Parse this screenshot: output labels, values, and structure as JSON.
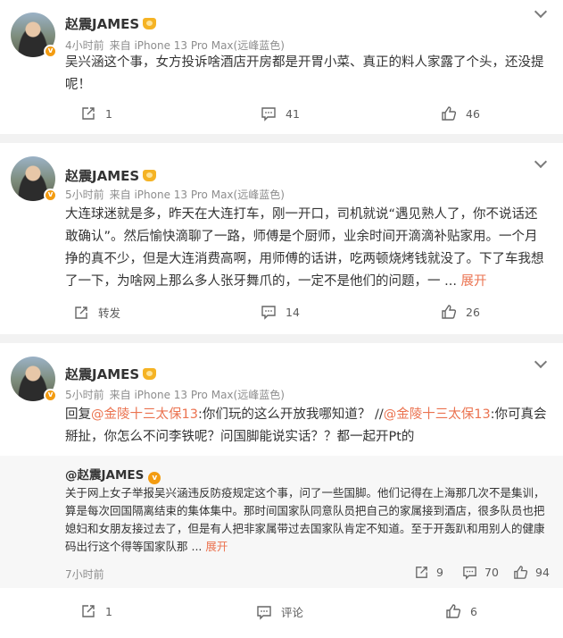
{
  "posts": [
    {
      "author": "赵震JAMES",
      "time": "4小时前",
      "source": "来自 iPhone 13 Pro Max(远峰蓝色)",
      "text": "吴兴涵这个事，女方投诉啥酒店开房都是开胃小菜、真正的料人家露了个头，还没提呢！",
      "repost": "1",
      "comments": "41",
      "likes": "46"
    },
    {
      "author": "赵震JAMES",
      "time": "5小时前",
      "source": "来自 iPhone 13 Pro Max(远峰蓝色)",
      "text": "大连球迷就是多，昨天在大连打车，刚一开口，司机就说“遇见熟人了，你不说话还敢确认”。然后愉快滴聊了一路，师傅是个厨师，业余时间开滴滴补贴家用。一个月挣的真不少，但是大连消费高啊，用师傅的话讲，吃两顿烧烤钱就没了。下了车我想了一下，为啥网上那么多人张牙舞爪的，一定不是他们的问题，一 ...",
      "more": "展开",
      "repost": "转发",
      "comments": "14",
      "likes": "26"
    },
    {
      "author": "赵震JAMES",
      "time": "5小时前",
      "source": "来自 iPhone 13 Pro Max(远峰蓝色)",
      "reply_prefix": "回复",
      "mention1": "@金陵十三太保13",
      "reply_mid": ":你们玩的这么开放我哪知道？ //",
      "mention2": "@金陵十三太保13",
      "reply_end": ":你可真会掰扯，你怎么不问李铁呢？问国脚能说实话？？都一起开Pt的",
      "quoted": {
        "author": "@赵震JAMES",
        "text": "关于网上女子举报吴兴涵违反防疫规定这个事，问了一些国脚。他们记得在上海那几次不是集训，算是每次回国隔离结束的集体集中。那时间国家队同意队员把自己的家属接到酒店，很多队员也把媳妇和女朋友接过去了，但是有人把非家属带过去国家队肯定不知道。至于开轰趴和用别人的健康码出行这个得等国家队那 ...",
        "more": "展开",
        "time": "7小时前",
        "repost": "9",
        "comments": "70",
        "likes": "94"
      },
      "repost": "1",
      "comments": "评论",
      "likes": "6"
    }
  ],
  "colors": {
    "link": "#eb7350",
    "badge": "#f39c12",
    "meta": "#8d8d8d"
  },
  "icons": [
    "share-icon",
    "comment-icon",
    "like-icon",
    "chevron-down-icon",
    "verified-badge-icon",
    "crown-icon"
  ]
}
